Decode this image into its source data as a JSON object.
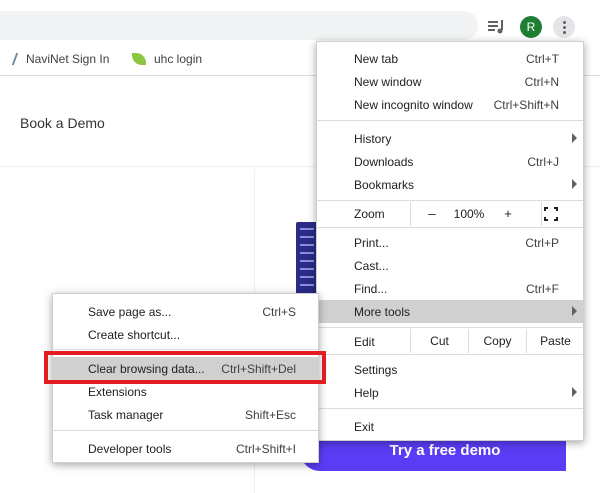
{
  "toolbar": {
    "avatar_letter": "R",
    "media_icon": "media-control-icon",
    "menu_icon": "three-dot-menu-icon"
  },
  "bookmarks": [
    {
      "label": "NaviNet Sign In",
      "icon": "slash-icon"
    },
    {
      "label": "uhc login",
      "icon": "leaf-icon"
    }
  ],
  "page": {
    "book_demo": "Book a Demo",
    "cta": "Try a free demo"
  },
  "main_menu": {
    "new_tab": {
      "label": "New tab",
      "shortcut": "Ctrl+T"
    },
    "new_window": {
      "label": "New window",
      "shortcut": "Ctrl+N"
    },
    "new_incognito": {
      "label": "New incognito window",
      "shortcut": "Ctrl+Shift+N"
    },
    "history": {
      "label": "History"
    },
    "downloads": {
      "label": "Downloads",
      "shortcut": "Ctrl+J"
    },
    "bookmarks": {
      "label": "Bookmarks"
    },
    "zoom": {
      "label": "Zoom",
      "minus": "–",
      "value": "100%",
      "plus": "+"
    },
    "print": {
      "label": "Print...",
      "shortcut": "Ctrl+P"
    },
    "cast": {
      "label": "Cast..."
    },
    "find": {
      "label": "Find...",
      "shortcut": "Ctrl+F"
    },
    "more_tools": {
      "label": "More tools"
    },
    "edit": {
      "label": "Edit",
      "cut": "Cut",
      "copy": "Copy",
      "paste": "Paste"
    },
    "settings": {
      "label": "Settings"
    },
    "help": {
      "label": "Help"
    },
    "exit": {
      "label": "Exit"
    }
  },
  "sub_menu": {
    "save_page": {
      "label": "Save page as...",
      "shortcut": "Ctrl+S"
    },
    "create_shortcut": {
      "label": "Create shortcut..."
    },
    "clear_browsing": {
      "label": "Clear browsing data...",
      "shortcut": "Ctrl+Shift+Del"
    },
    "extensions": {
      "label": "Extensions"
    },
    "task_manager": {
      "label": "Task manager",
      "shortcut": "Shift+Esc"
    },
    "developer_tools": {
      "label": "Developer tools",
      "shortcut": "Ctrl+Shift+I"
    }
  },
  "colors": {
    "highlight_box": "#e31c23",
    "cta": "#5b3cf5",
    "avatar": "#1e7e34"
  }
}
